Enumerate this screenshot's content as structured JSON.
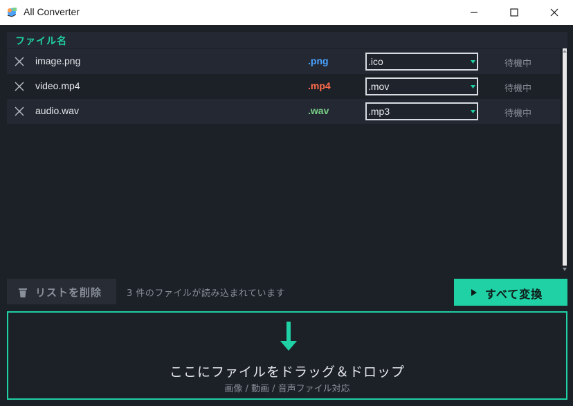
{
  "window": {
    "title": "All Converter",
    "icon": "app-logo-icon"
  },
  "list": {
    "header": "ファイル名",
    "rows": [
      {
        "name": "image.png",
        "ext": ".png",
        "ext_color": "#4aa3ff",
        "target": ".ico",
        "status": "待機中"
      },
      {
        "name": "video.mp4",
        "ext": ".mp4",
        "ext_color": "#ff6b4a",
        "target": ".mov",
        "status": "待機中"
      },
      {
        "name": "audio.wav",
        "ext": ".wav",
        "ext_color": "#7bd389",
        "target": ".mp3",
        "status": "待機中"
      }
    ]
  },
  "toolbar": {
    "clear_label": "リストを削除",
    "file_count_text": "3 件のファイルが読み込まれています",
    "convert_label": "すべて変換"
  },
  "dropzone": {
    "main_text": "ここにファイルをドラッグ＆ドロップ",
    "sub_text": "画像 / 動画 / 音声ファイル対応"
  },
  "colors": {
    "accent": "#1fd1a5",
    "background": "#1c2027",
    "row_alt": "#232832"
  }
}
